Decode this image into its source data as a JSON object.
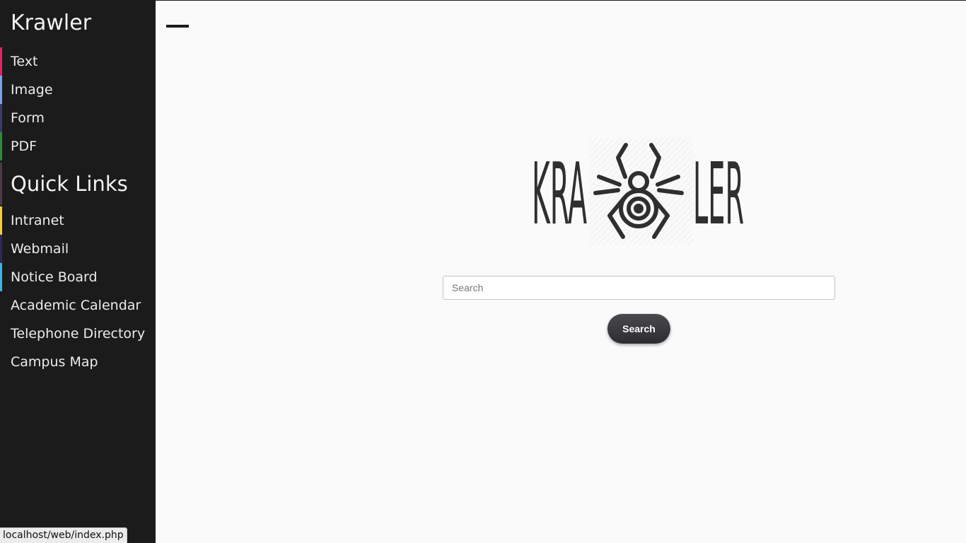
{
  "sidebar": {
    "brand": "Krawler",
    "categories": [
      {
        "label": "Text",
        "color": "#e0245e"
      },
      {
        "label": "Image",
        "color": "#7aa4e8"
      },
      {
        "label": "Form",
        "color": "#3b3a6e"
      },
      {
        "label": "PDF",
        "color": "#2f8a38"
      }
    ],
    "quick_links_title": "Quick Links",
    "quick_links": [
      {
        "label": "Intranet",
        "color": "#f2cf3d"
      },
      {
        "label": "Webmail",
        "color": "#2a2a5a"
      },
      {
        "label": "Notice Board",
        "color": "#40b4e0"
      },
      {
        "label": "Academic Calendar",
        "color": ""
      },
      {
        "label": "Telephone Directory",
        "color": ""
      },
      {
        "label": "Campus Map",
        "color": ""
      }
    ]
  },
  "logo": {
    "left_text": "KRA",
    "right_text": "LER",
    "icon": "spider-icon"
  },
  "search": {
    "placeholder": "Search",
    "value": "",
    "button_label": "Search"
  },
  "status_bar": {
    "url": "localhost/web/index.php"
  },
  "colors": {
    "sidebar_bg": "#1b1b1b",
    "page_bg": "#fafafa",
    "button_bg": "#3a3a3e"
  }
}
